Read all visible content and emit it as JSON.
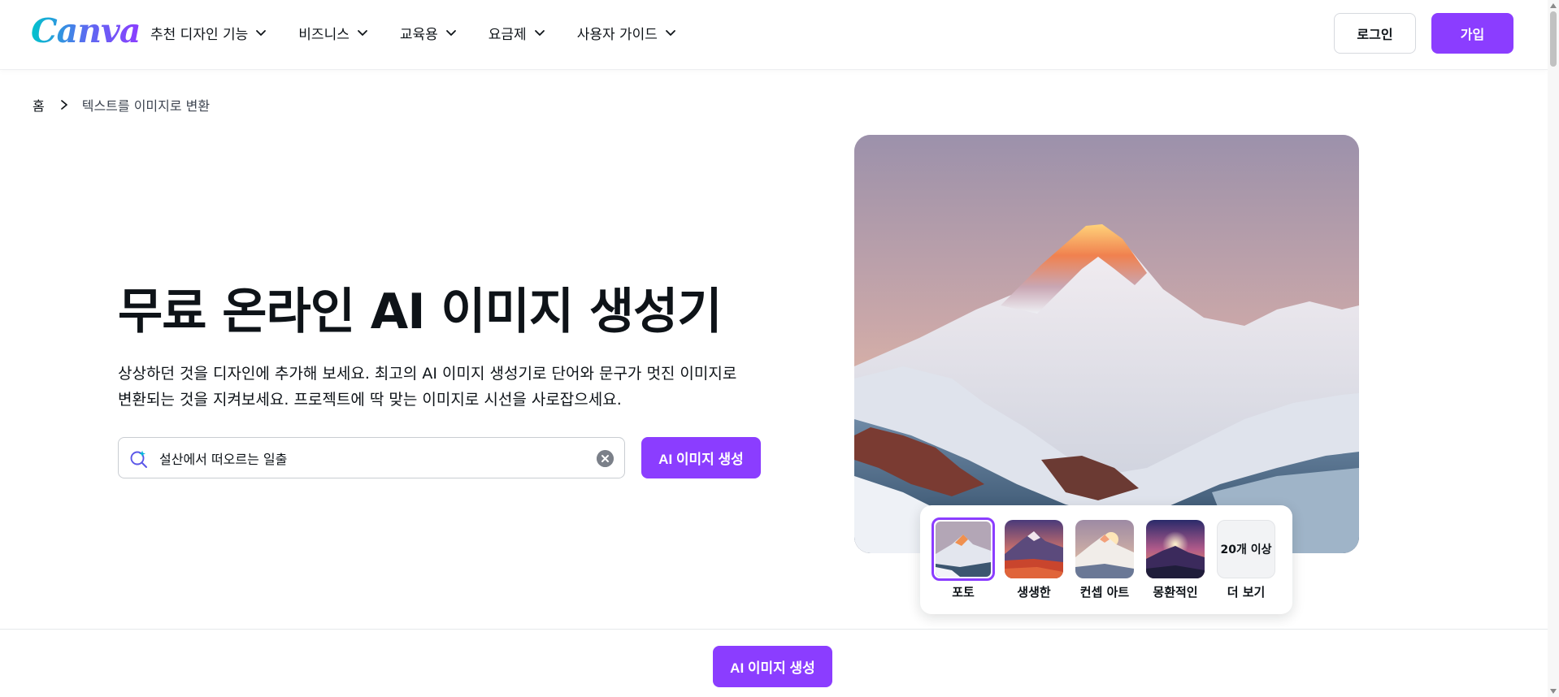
{
  "header": {
    "logo_text": "Canva",
    "nav": [
      {
        "label": "추천 디자인 기능"
      },
      {
        "label": "비즈니스"
      },
      {
        "label": "교육용"
      },
      {
        "label": "요금제"
      },
      {
        "label": "사용자 가이드"
      }
    ],
    "login_label": "로그인",
    "signup_label": "가입"
  },
  "breadcrumb": {
    "home": "홈",
    "current": "텍스트를 이미지로 변환"
  },
  "hero": {
    "title": "무료 온라인 AI 이미지 생성기",
    "description_line1": "상상하던 것을 디자인에 추가해 보세요. 최고의 AI 이미지 생성기로 단어와 문구가 멋진 이미지로",
    "description_line2": "변환되는 것을 지켜보세요. 프로젝트에 딱 맞는 이미지로 시선을 사로잡으세요.",
    "prompt_value": "설산에서 떠오르는 일출",
    "generate_label": "AI 이미지 생성"
  },
  "style_picker": {
    "options": [
      {
        "label": "포토",
        "selected": true
      },
      {
        "label": "생생한",
        "selected": false
      },
      {
        "label": "컨셉 아트",
        "selected": false
      },
      {
        "label": "몽환적인",
        "selected": false
      }
    ],
    "more_thumb_text": "20개 이상",
    "more_label": "더 보기"
  },
  "bottom_bar": {
    "generate_label": "AI 이미지 생성"
  },
  "colors": {
    "brand_purple": "#8b3dff",
    "text_dark": "#0e1318"
  },
  "icons": {
    "nav_chevron": "chevron-down-icon",
    "breadcrumb_separator": "chevron-right-icon",
    "search": "sparkle-search-icon",
    "clear": "clear-icon"
  }
}
